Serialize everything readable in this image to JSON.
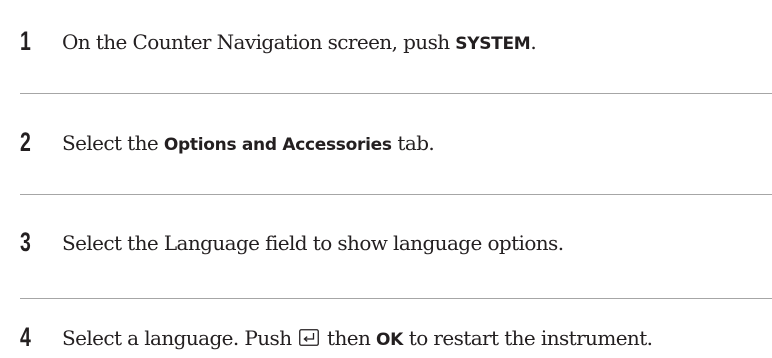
{
  "steps": [
    {
      "number": "1",
      "before": "On the Counter Navigation screen, push ",
      "keyword": "SYSTEM",
      "after": "."
    },
    {
      "number": "2",
      "before": "Select the ",
      "keyword": "Options and Accessories",
      "after": " tab."
    },
    {
      "number": "3",
      "text": "Select the Language field to show language options."
    },
    {
      "number": "4",
      "before": "Select a language. Push ",
      "icon": "enter-key-icon",
      "middle": " then ",
      "keyword": "OK",
      "after": " to restart the instrument."
    }
  ],
  "colors": {
    "text": "#231f20",
    "divider": "#a6a6a6"
  }
}
